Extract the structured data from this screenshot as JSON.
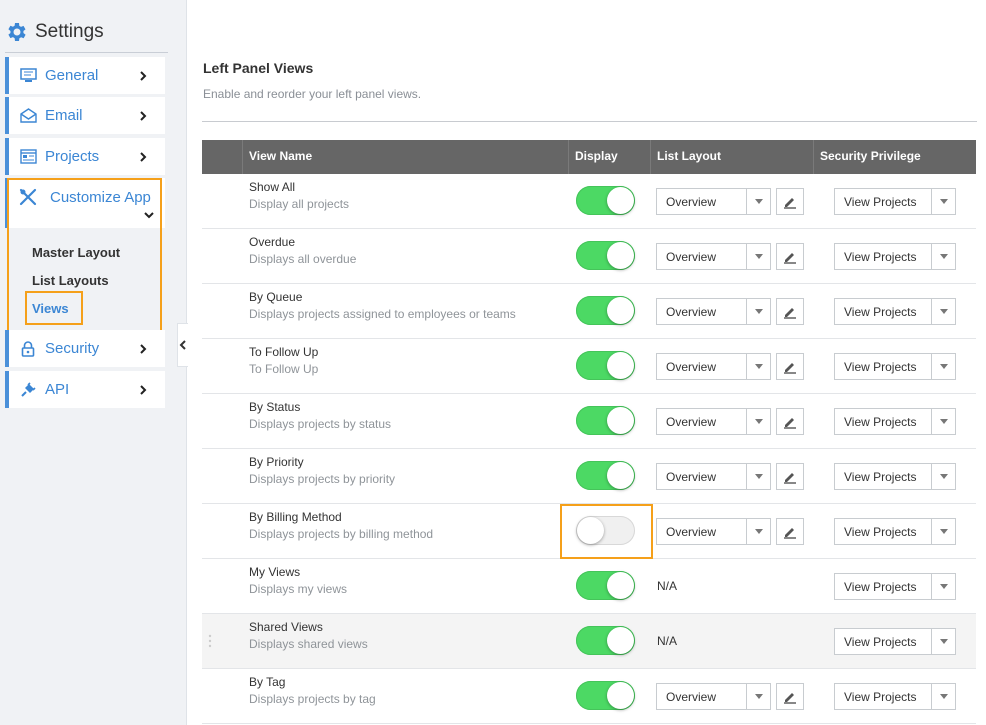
{
  "sidebar": {
    "title": "Settings",
    "items": [
      {
        "label": "General",
        "icon": "monitor-icon"
      },
      {
        "label": "Email",
        "icon": "envelope-icon"
      },
      {
        "label": "Projects",
        "icon": "projects-icon"
      },
      {
        "label": "Customize App",
        "icon": "tools-icon"
      },
      {
        "label": "Security",
        "icon": "lock-icon"
      },
      {
        "label": "API",
        "icon": "plug-icon"
      }
    ],
    "customize_sub": [
      {
        "label": "Master Layout"
      },
      {
        "label": "List Layouts"
      },
      {
        "label": "Views",
        "active": true
      }
    ]
  },
  "main": {
    "title": "Left Panel Views",
    "subtitle": "Enable and reorder your left panel views.",
    "columns": [
      "View Name",
      "Display",
      "List Layout",
      "Security Privilege"
    ],
    "rows": [
      {
        "name": "Show All",
        "desc": "Display all projects",
        "display": true,
        "layout": "Overview",
        "privilege": "View Projects"
      },
      {
        "name": "Overdue",
        "desc": "Displays all overdue",
        "display": true,
        "layout": "Overview",
        "privilege": "View Projects"
      },
      {
        "name": "By Queue",
        "desc": "Displays projects assigned to employees or teams",
        "display": true,
        "layout": "Overview",
        "privilege": "View Projects"
      },
      {
        "name": "To Follow Up",
        "desc": "To Follow Up",
        "display": true,
        "layout": "Overview",
        "privilege": "View Projects"
      },
      {
        "name": "By Status",
        "desc": "Displays projects by status",
        "display": true,
        "layout": "Overview",
        "privilege": "View Projects"
      },
      {
        "name": "By Priority",
        "desc": "Displays projects by priority",
        "display": true,
        "layout": "Overview",
        "privilege": "View Projects"
      },
      {
        "name": "By Billing Method",
        "desc": "Displays projects by billing method",
        "display": false,
        "layout": "Overview",
        "privilege": "View Projects"
      },
      {
        "name": "My Views",
        "desc": "Displays my views",
        "display": true,
        "layout": "N/A",
        "privilege": "View Projects"
      },
      {
        "name": "Shared Views",
        "desc": "Displays shared views",
        "display": true,
        "layout": "N/A",
        "privilege": "View Projects"
      },
      {
        "name": "By Tag",
        "desc": "Displays projects by tag",
        "display": true,
        "layout": "Overview",
        "privilege": "View Projects"
      }
    ]
  }
}
